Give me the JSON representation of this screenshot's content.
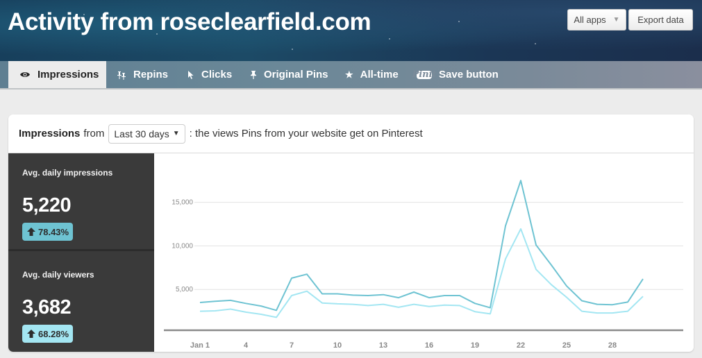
{
  "header": {
    "title": "Activity from roseclearfield.com",
    "apps_dropdown": "All apps",
    "export_button": "Export data"
  },
  "tabs": [
    {
      "label": "Impressions",
      "icon": "eye-icon",
      "active": true
    },
    {
      "label": "Repins",
      "icon": "pushpins-icon",
      "active": false
    },
    {
      "label": "Clicks",
      "icon": "cursor-icon",
      "active": false
    },
    {
      "label": "Original Pins",
      "icon": "pin-icon",
      "active": false
    },
    {
      "label": "All-time",
      "icon": "star-icon",
      "active": false
    },
    {
      "label": "Save button",
      "icon": "pinit-icon",
      "active": false
    }
  ],
  "panel": {
    "metric": "Impressions",
    "from_label": "from",
    "range": "Last 30 days",
    "description": ": the views Pins from your website get on Pinterest"
  },
  "stats": [
    {
      "label": "Avg. daily impressions",
      "value": "5,220",
      "change": "78.43%",
      "direction": "up",
      "color": "#6ec3d2"
    },
    {
      "label": "Avg. daily viewers",
      "value": "3,682",
      "change": "68.28%",
      "direction": "up",
      "color": "#a3e6f2"
    }
  ],
  "chart_data": {
    "type": "line",
    "title": "",
    "xlabel": "",
    "ylabel": "",
    "x": [
      1,
      2,
      3,
      4,
      5,
      6,
      7,
      8,
      9,
      10,
      11,
      12,
      13,
      14,
      15,
      16,
      17,
      18,
      19,
      20,
      21,
      22,
      23,
      24,
      25,
      26,
      27,
      28,
      29,
      30
    ],
    "x_tick_values": [
      1,
      4,
      7,
      10,
      13,
      16,
      19,
      22,
      25,
      28
    ],
    "x_tick_labels": [
      "Jan 1",
      "4",
      "7",
      "10",
      "13",
      "16",
      "19",
      "22",
      "25",
      "28"
    ],
    "y_ticks": [
      5000,
      10000,
      15000
    ],
    "y_tick_labels": [
      "5,000",
      "10,000",
      "15,000"
    ],
    "ylim": [
      0,
      18000
    ],
    "xlim": [
      0,
      31
    ],
    "grid": true,
    "legend": "none",
    "series": [
      {
        "name": "Impressions",
        "color": "#6ec3d2",
        "values": [
          3500,
          3650,
          3750,
          3400,
          3100,
          2600,
          6300,
          6750,
          4500,
          4500,
          4350,
          4300,
          4400,
          4050,
          4700,
          4050,
          4300,
          4300,
          3400,
          2900,
          12300,
          17500,
          10100,
          7800,
          5400,
          3700,
          3300,
          3250,
          3550,
          6200
        ]
      },
      {
        "name": "Viewers",
        "color": "#a3e6f2",
        "values": [
          2500,
          2550,
          2750,
          2400,
          2150,
          1800,
          4300,
          4800,
          3450,
          3350,
          3300,
          3150,
          3300,
          2950,
          3300,
          3050,
          3200,
          3150,
          2450,
          2200,
          8500,
          11950,
          7300,
          5550,
          4100,
          2500,
          2300,
          2300,
          2500,
          4200
        ]
      }
    ]
  }
}
